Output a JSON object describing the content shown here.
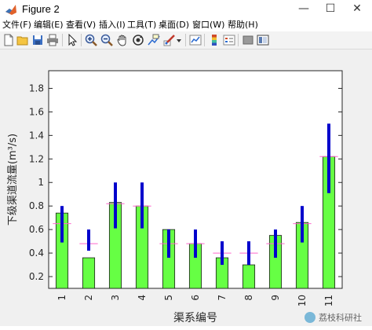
{
  "window": {
    "title": "Figure 2",
    "minimize_glyph": "—",
    "maximize_glyph": "☐",
    "close_glyph": "✕"
  },
  "menu": {
    "items": [
      {
        "name": "menu-file",
        "label": "文件(F)"
      },
      {
        "name": "menu-edit",
        "label": "编辑(E)"
      },
      {
        "name": "menu-view",
        "label": "查看(V)"
      },
      {
        "name": "menu-insert",
        "label": "插入(I)"
      },
      {
        "name": "menu-tools",
        "label": "工具(T)"
      },
      {
        "name": "menu-desktop",
        "label": "桌面(D)"
      },
      {
        "name": "menu-window",
        "label": "窗口(W)"
      },
      {
        "name": "menu-help",
        "label": "帮助(H)"
      }
    ]
  },
  "toolbar": {
    "icons": [
      "new-figure-icon",
      "open-file-icon",
      "save-icon",
      "print-icon",
      "edit-plot-arrow-icon",
      "zoom-in-icon",
      "zoom-out-icon",
      "pan-hand-icon",
      "rotate-3d-icon",
      "data-cursor-icon",
      "brush-icon",
      "dropdown-arrow-icon",
      "link-plot-icon",
      "insert-colorbar-icon",
      "insert-legend-icon",
      "hide-plot-tools-icon",
      "show-plot-tools-icon"
    ]
  },
  "colors": {
    "bar_fill": "#66ff44",
    "error_bar": "#0000cc",
    "threshold_line": "#ff66cc"
  },
  "watermark": "荔枝科研社",
  "chart_data": {
    "type": "bar",
    "title": "",
    "xlabel": "渠系编号",
    "ylabel": "下级渠道流量(m³/s)",
    "categories": [
      "1",
      "2",
      "3",
      "4",
      "5",
      "6",
      "7",
      "8",
      "9",
      "10",
      "11"
    ],
    "values": [
      0.74,
      0.36,
      0.83,
      0.8,
      0.6,
      0.48,
      0.36,
      0.3,
      0.55,
      0.66,
      1.22
    ],
    "error_low": [
      0.49,
      0.42,
      0.61,
      0.61,
      0.36,
      0.36,
      0.3,
      0.3,
      0.36,
      0.49,
      0.91
    ],
    "error_high": [
      0.8,
      0.6,
      1.0,
      1.0,
      0.6,
      0.6,
      0.5,
      0.5,
      0.6,
      0.8,
      1.5
    ],
    "threshold": [
      0.65,
      0.48,
      0.82,
      0.8,
      0.48,
      0.48,
      0.4,
      0.4,
      0.48,
      0.65,
      1.22
    ],
    "ylim": [
      0.1,
      1.95
    ],
    "yticks": [
      "0.2",
      "0.4",
      "0.6",
      "0.8",
      "1",
      "1.2",
      "1.4",
      "1.6",
      "1.8"
    ],
    "ytick_values": [
      0.2,
      0.4,
      0.6,
      0.8,
      1.0,
      1.2,
      1.4,
      1.6,
      1.8
    ],
    "grid": false,
    "legend": "none"
  }
}
